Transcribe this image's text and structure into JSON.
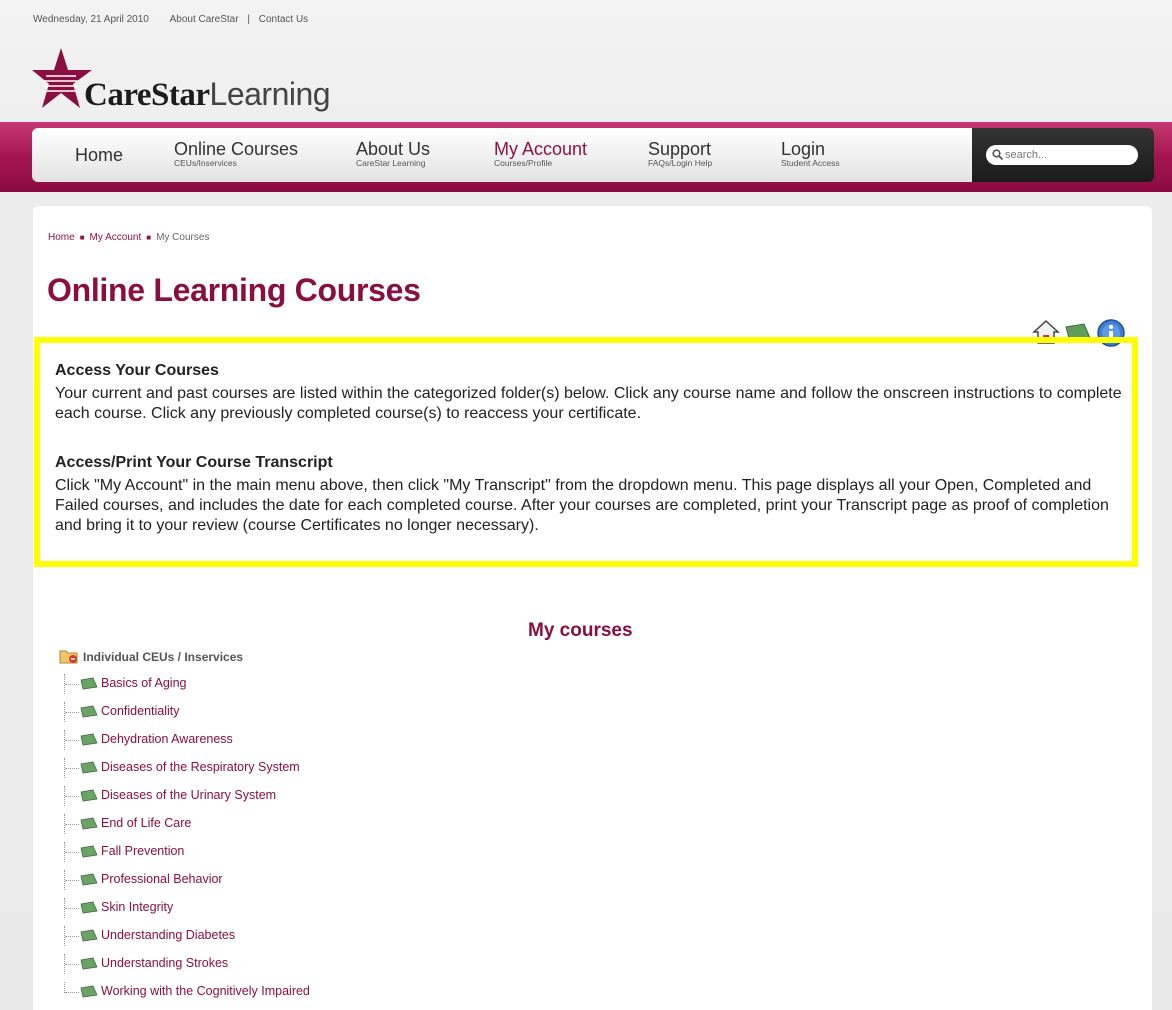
{
  "topbar": {
    "date": "Wednesday, 21 April 2010",
    "about_link": "About CareStar",
    "separator": "|",
    "contact_link": "Contact Us"
  },
  "logo": {
    "brand_bold": "CareStar",
    "brand_light": "Learning"
  },
  "nav": {
    "items": [
      {
        "label": "Home",
        "sub": ""
      },
      {
        "label": "Online Courses",
        "sub": "CEUs/Inservices"
      },
      {
        "label": "About Us",
        "sub": "CareStar Learning"
      },
      {
        "label": "My Account",
        "sub": "Courses/Profile"
      },
      {
        "label": "Support",
        "sub": "FAQs/Login Help"
      },
      {
        "label": "Login",
        "sub": "Student Access"
      }
    ],
    "search_placeholder": "search..."
  },
  "breadcrumb": {
    "items": [
      "Home",
      "My Account",
      "My Courses"
    ]
  },
  "page_title": "Online Learning Courses",
  "sections": [
    {
      "heading": "Access Your Courses",
      "body": "Your current and past courses are listed within the categorized folder(s) below.  Click any course name and follow the onscreen instructions to complete each course.  Click any previously completed course(s) to reaccess your certificate."
    },
    {
      "heading": "Access/Print Your Course Transcript",
      "body": "Click \"My Account\" in the main menu above, then click \"My Transcript\" from the dropdown menu. This page displays all your Open, Completed and Failed courses, and includes the date for each completed course.  After your courses are completed, print your Transcript page as proof of completion and bring it to your review (course Certificates no longer necessary)."
    }
  ],
  "my_courses": {
    "title": "My courses",
    "folder": "Individual CEUs / Inservices",
    "courses": [
      "Basics of Aging",
      "Confidentiality",
      "Dehydration Awareness",
      "Diseases of the Respiratory System",
      "Diseases of the Urinary System",
      "End of Life Care",
      "Fall Prevention",
      "Professional Behavior",
      "Skin Integrity",
      "Understanding Diabetes",
      "Understanding Strokes",
      "Working with the Cognitively Impaired"
    ]
  },
  "colors": {
    "brand": "#8a0f40",
    "nav_band": "#a5154f",
    "highlight": "#ffff00"
  }
}
